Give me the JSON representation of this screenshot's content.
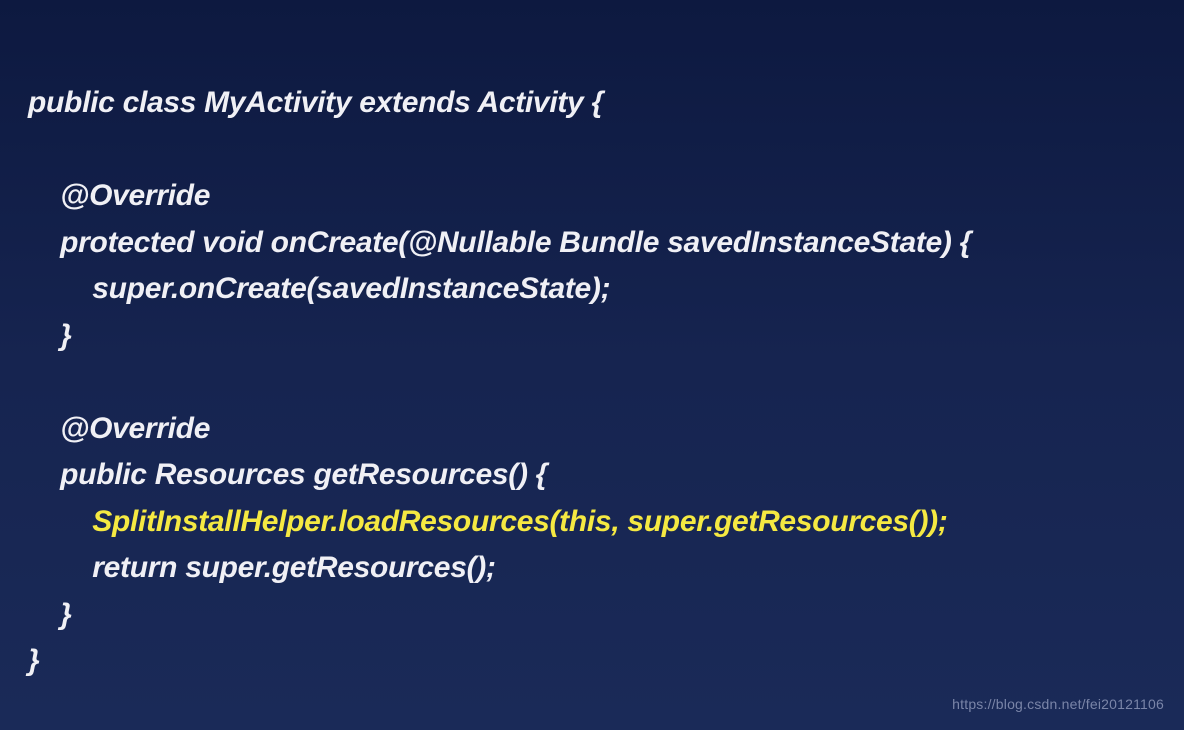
{
  "code": {
    "line1": "public class MyActivity extends Activity {",
    "line2": "",
    "line3": "    @Override",
    "line4": "    protected void onCreate(@Nullable Bundle savedInstanceState) {",
    "line5": "        super.onCreate(savedInstanceState);",
    "line6": "    }",
    "line7": "",
    "line8": "    @Override",
    "line9": "    public Resources getResources() {",
    "line10_highlight": "        SplitInstallHelper.loadResources(this, super.getResources());",
    "line11": "        return super.getResources();",
    "line12": "    }",
    "line13": "}"
  },
  "watermark": "https://blog.csdn.net/fei20121106"
}
